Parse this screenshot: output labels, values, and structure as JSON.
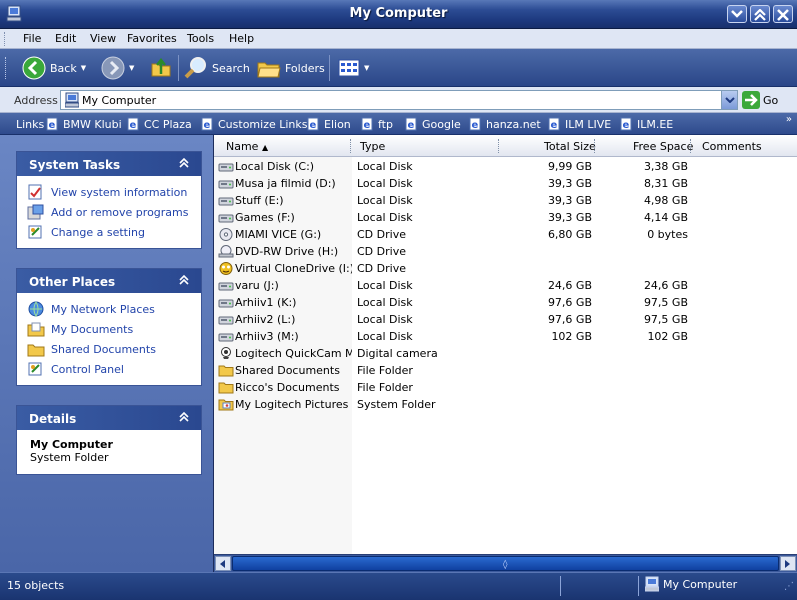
{
  "window": {
    "title": "My Computer"
  },
  "menu": [
    "File",
    "Edit",
    "View",
    "Favorites",
    "Tools",
    "Help"
  ],
  "toolbar": {
    "back_label": "Back",
    "search_label": "Search",
    "folders_label": "Folders"
  },
  "address": {
    "label": "Address",
    "value": "My Computer",
    "go_label": "Go"
  },
  "links": {
    "label": "Links",
    "items": [
      "BMW Klubi",
      "CC Plaza",
      "Customize Links",
      "Elion",
      "ftp",
      "Google",
      "hanza.net",
      "ILM LIVE",
      "ILM.EE"
    ]
  },
  "tasks": {
    "system": {
      "title": "System Tasks",
      "items": [
        "View system information",
        "Add or remove programs",
        "Change a setting"
      ]
    },
    "other": {
      "title": "Other Places",
      "items": [
        "My Network Places",
        "My Documents",
        "Shared Documents",
        "Control Panel"
      ]
    },
    "details": {
      "title": "Details",
      "name": "My Computer",
      "kind": "System Folder"
    }
  },
  "columns": {
    "name": "Name",
    "type": "Type",
    "total": "Total Size",
    "free": "Free Space",
    "comments": "Comments"
  },
  "files": [
    {
      "icon": "hard-disk-icon",
      "name": "Local Disk (C:)",
      "type": "Local Disk",
      "total": "9,99 GB",
      "free": "3,38 GB"
    },
    {
      "icon": "hard-disk-icon",
      "name": "Musa ja filmid (D:)",
      "type": "Local Disk",
      "total": "39,3 GB",
      "free": "8,31 GB"
    },
    {
      "icon": "hard-disk-icon",
      "name": "Stuff (E:)",
      "type": "Local Disk",
      "total": "39,3 GB",
      "free": "4,98 GB"
    },
    {
      "icon": "hard-disk-icon",
      "name": "Games (F:)",
      "type": "Local Disk",
      "total": "39,3 GB",
      "free": "4,14 GB"
    },
    {
      "icon": "cd-drive-icon",
      "name": "MIAMI VICE (G:)",
      "type": "CD Drive",
      "total": "6,80 GB",
      "free": "0 bytes"
    },
    {
      "icon": "dvd-drive-icon",
      "name": "DVD-RW Drive (H:)",
      "type": "CD Drive",
      "total": "",
      "free": ""
    },
    {
      "icon": "virtual-drive-icon",
      "name": "Virtual CloneDrive (I:)",
      "type": "CD Drive",
      "total": "",
      "free": ""
    },
    {
      "icon": "hard-disk-icon",
      "name": "varu (J:)",
      "type": "Local Disk",
      "total": "24,6 GB",
      "free": "24,6 GB"
    },
    {
      "icon": "hard-disk-icon",
      "name": "Arhiiv1 (K:)",
      "type": "Local Disk",
      "total": "97,6 GB",
      "free": "97,5 GB"
    },
    {
      "icon": "hard-disk-icon",
      "name": "Arhiiv2 (L:)",
      "type": "Local Disk",
      "total": "97,6 GB",
      "free": "97,5 GB"
    },
    {
      "icon": "hard-disk-icon",
      "name": "Arhiiv3 (M:)",
      "type": "Local Disk",
      "total": "102 GB",
      "free": "102 GB"
    },
    {
      "icon": "camera-icon",
      "name": "Logitech QuickCam M...",
      "type": "Digital camera",
      "total": "",
      "free": ""
    },
    {
      "icon": "folder-icon",
      "name": "Shared Documents",
      "type": "File Folder",
      "total": "",
      "free": ""
    },
    {
      "icon": "folder-icon",
      "name": "Ricco's Documents",
      "type": "File Folder",
      "total": "",
      "free": ""
    },
    {
      "icon": "pictures-folder-icon",
      "name": "My Logitech Pictures",
      "type": "System Folder",
      "total": "",
      "free": ""
    }
  ],
  "status": {
    "count": "15 objects",
    "location": "My Computer"
  }
}
